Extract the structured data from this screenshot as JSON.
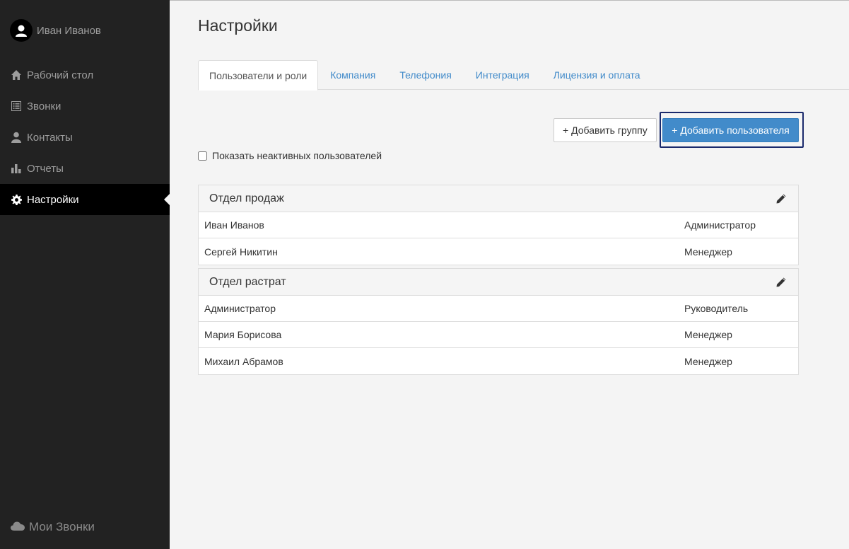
{
  "sidebar": {
    "user_name": "Иван Иванов",
    "items": [
      {
        "label": "Рабочий стол",
        "icon": "home-icon",
        "active": false
      },
      {
        "label": "Звонки",
        "icon": "list-icon",
        "active": false
      },
      {
        "label": "Контакты",
        "icon": "user-icon",
        "active": false
      },
      {
        "label": "Отчеты",
        "icon": "bar-chart-icon",
        "active": false
      },
      {
        "label": "Настройки",
        "icon": "gear-icon",
        "active": true
      }
    ],
    "brand": "Мои Звонки"
  },
  "page": {
    "title": "Настройки"
  },
  "tabs": [
    {
      "label": "Пользователи и роли",
      "active": true
    },
    {
      "label": "Компания",
      "active": false
    },
    {
      "label": "Телефония",
      "active": false
    },
    {
      "label": "Интеграция",
      "active": false
    },
    {
      "label": "Лицензия и оплата",
      "active": false
    }
  ],
  "actions": {
    "add_group": "+ Добавить группу",
    "add_user": "+ Добавить пользователя"
  },
  "filters": {
    "show_inactive_label": "Показать неактивных пользователей",
    "show_inactive_checked": false
  },
  "groups": [
    {
      "title": "Отдел продаж",
      "users": [
        {
          "name": "Иван Иванов",
          "role": "Администратор"
        },
        {
          "name": "Сергей Никитин",
          "role": "Менеджер"
        }
      ]
    },
    {
      "title": "Отдел растрат",
      "users": [
        {
          "name": "Администратор",
          "role": "Руководитель"
        },
        {
          "name": "Мария Борисова",
          "role": "Менеджер"
        },
        {
          "name": "Михаил Абрамов",
          "role": "Менеджер"
        }
      ]
    }
  ],
  "colors": {
    "sidebar_bg": "#222222",
    "active_item_bg": "#000000",
    "accent": "#428bca",
    "focus_outline": "#1a2a6c"
  }
}
